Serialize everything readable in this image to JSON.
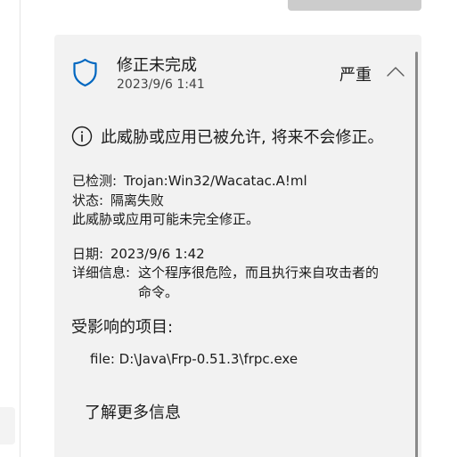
{
  "card": {
    "title": "修正未完成",
    "timestamp": "2023/9/6 1:41",
    "severity": "严重",
    "icon": "shield-icon",
    "expand_icon": "chevron-up-icon",
    "warning": {
      "icon": "info-icon",
      "text": "此威胁或应用已被允许, 将来不会修正。"
    },
    "details": {
      "detected_label": "已检测:",
      "detected_value": "Trojan:Win32/Wacatac.A!ml",
      "status_label": "状态:",
      "status_value": "隔离失败",
      "note": "此威胁或应用可能未完全修正。",
      "date_label": "日期:",
      "date_value": "2023/9/6 1:42",
      "info_label": "详细信息:",
      "info_value_line1": "这个程序很危险，而且执行来自攻击者的",
      "info_value_line2": "命令。"
    },
    "affected": {
      "heading": "受影响的项目:",
      "items": [
        "file: D:\\Java\\Frp-0.51.3\\frpc.exe"
      ]
    },
    "more_info_label": "了解更多信息"
  },
  "colors": {
    "accent": "#0067c0",
    "card_background": "#f2f2f2",
    "top_button": "#cccccc"
  }
}
